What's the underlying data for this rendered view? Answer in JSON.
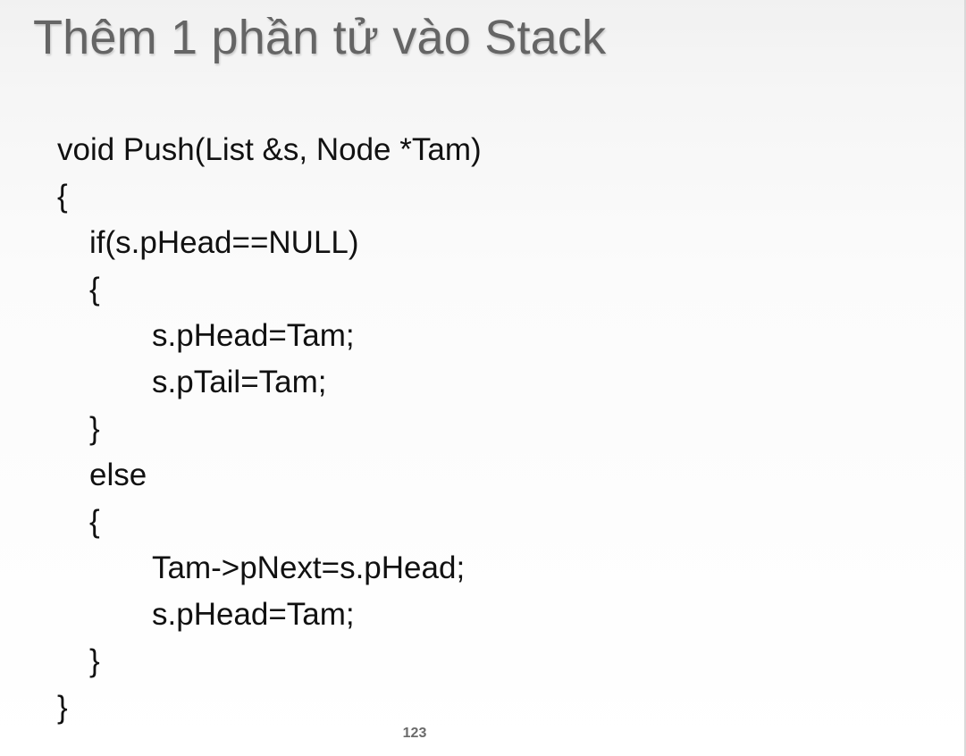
{
  "slide": {
    "title": "Thêm 1 phần tử vào Stack",
    "page_number": "123",
    "code_lines": [
      "void Push(List &s, Node *Tam)",
      "{",
      "if(s.pHead==NULL)",
      "{",
      "s.pHead=Tam;",
      "s.pTail=Tam;",
      "}",
      "else",
      "{",
      "Tam->pNext=s.pHead;",
      "s.pHead=Tam;",
      "}",
      "}"
    ]
  },
  "colors": {
    "title": "#656565",
    "code_text": "#111111",
    "background_top": "#f1f1f1",
    "background_bottom": "#ffffff"
  }
}
